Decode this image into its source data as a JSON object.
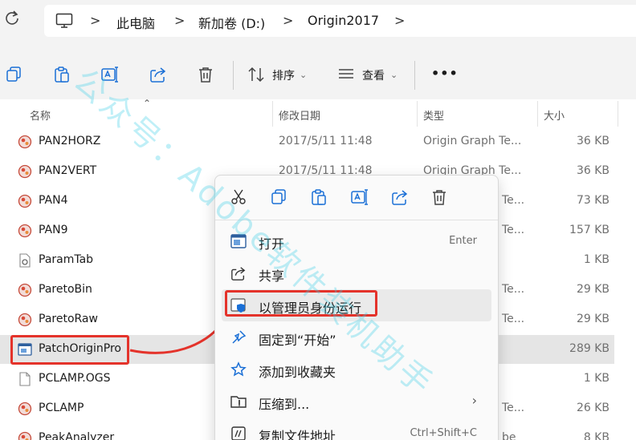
{
  "address_bar": {
    "crumbs": [
      "此电脑",
      "新加卷 (D:)",
      "Origin2017"
    ]
  },
  "toolbar": {
    "sort_label": "排序",
    "view_label": "查看",
    "more_label": "•••"
  },
  "columns": {
    "name": "名称",
    "date": "修改日期",
    "type": "类型",
    "size": "大小"
  },
  "files": [
    {
      "name": "PAN2HORZ",
      "date": "2017/5/11 11:48",
      "type": "Origin Graph Te...",
      "size": "36 KB",
      "icon": "origin-graph-icon"
    },
    {
      "name": "PAN2VERT",
      "date": "2017/5/11 11:48",
      "type": "Origin Graph Te...",
      "size": "36 KB",
      "icon": "origin-graph-icon"
    },
    {
      "name": "PAN4",
      "date": "",
      "type": "Te...",
      "size": "73 KB",
      "icon": "origin-graph-icon"
    },
    {
      "name": "PAN9",
      "date": "",
      "type": "Te...",
      "size": "157 KB",
      "icon": "origin-graph-icon"
    },
    {
      "name": "ParamTab",
      "date": "",
      "type": "",
      "size": "1 KB",
      "icon": "settings-file-icon"
    },
    {
      "name": "ParetoBin",
      "date": "",
      "type": "Te...",
      "size": "29 KB",
      "icon": "origin-graph-icon"
    },
    {
      "name": "ParetoRaw",
      "date": "",
      "type": "Te...",
      "size": "29 KB",
      "icon": "origin-graph-icon"
    },
    {
      "name": "PatchOriginPro",
      "date": "",
      "type": "",
      "size": "289 KB",
      "icon": "application-icon"
    },
    {
      "name": "PCLAMP.OGS",
      "date": "",
      "type": "",
      "size": "1 KB",
      "icon": "blank-file-icon"
    },
    {
      "name": "PCLAMP",
      "date": "",
      "type": "Te...",
      "size": "26 KB",
      "icon": "origin-graph-icon"
    },
    {
      "name": "PeakAnalyzer",
      "date": "",
      "type": "be",
      "size": "8 KB",
      "icon": "origin-graph-icon"
    }
  ],
  "context_menu": {
    "items": [
      {
        "label": "打开",
        "shortcut": "Enter",
        "icon": "open-window-icon"
      },
      {
        "label": "共享",
        "shortcut": "",
        "icon": "share-icon"
      },
      {
        "label": "以管理员身份运行",
        "shortcut": "",
        "icon": "shield-icon"
      },
      {
        "label": "固定到“开始”",
        "shortcut": "",
        "icon": "pin-icon"
      },
      {
        "label": "添加到收藏夹",
        "shortcut": "",
        "icon": "star-icon"
      },
      {
        "label": "压缩到...",
        "shortcut": "",
        "icon": "zip-folder-icon",
        "submenu": "›"
      },
      {
        "label": "复制文件地址",
        "shortcut": "Ctrl+Shift+C",
        "icon": "copy-path-icon"
      }
    ]
  },
  "watermark": "公众号：Adobe软件装机助手",
  "colors": {
    "highlight_red": "#e4332b",
    "accent_blue": "#1a6fd6"
  }
}
